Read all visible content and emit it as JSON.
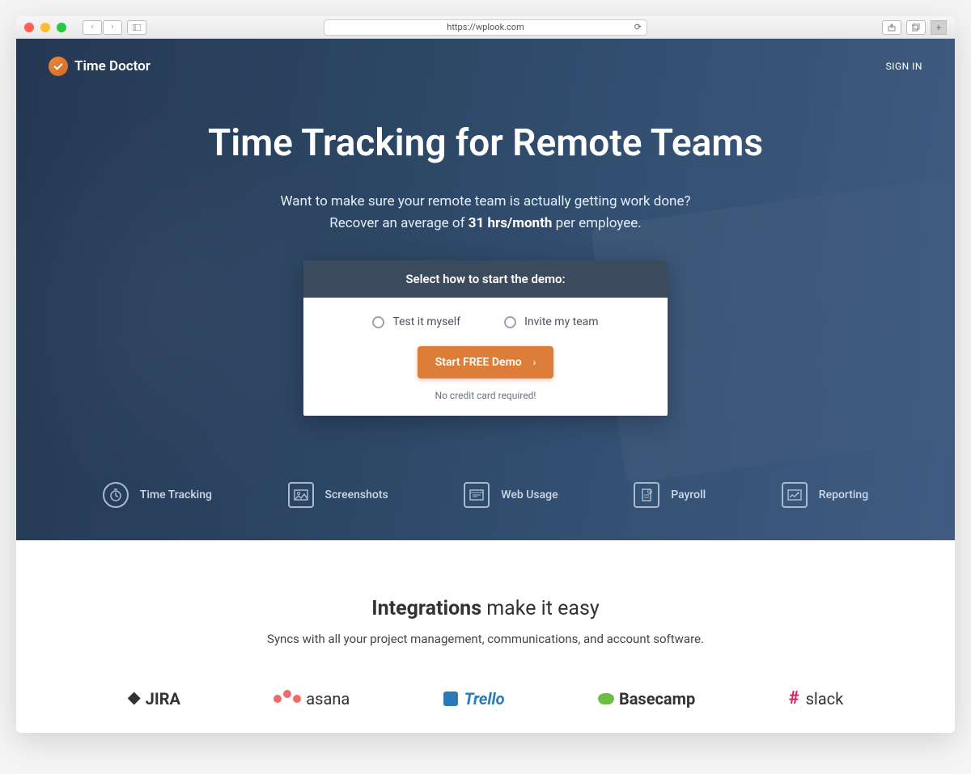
{
  "browser": {
    "url": "https://wplook.com"
  },
  "header": {
    "brand": "Time Doctor",
    "signin": "SIGN IN"
  },
  "hero": {
    "title": "Time Tracking for Remote Teams",
    "subtitle_line1": "Want to make sure your remote team is actually getting work done?",
    "subtitle_line2_pre": "Recover an average of ",
    "subtitle_line2_bold": "31 hrs/month",
    "subtitle_line2_post": " per employee."
  },
  "card": {
    "heading": "Select how to start the demo:",
    "option1": "Test it myself",
    "option2": "Invite my team",
    "cta": "Start FREE Demo",
    "note": "No credit card required!"
  },
  "features": [
    "Time Tracking",
    "Screenshots",
    "Web Usage",
    "Payroll",
    "Reporting"
  ],
  "integrations": {
    "title_bold": "Integrations",
    "title_light": " make it easy",
    "subtitle": "Syncs with all your project management, communications, and account software.",
    "logos": [
      "JIRA",
      "asana",
      "Trello",
      "Basecamp",
      "slack"
    ]
  }
}
